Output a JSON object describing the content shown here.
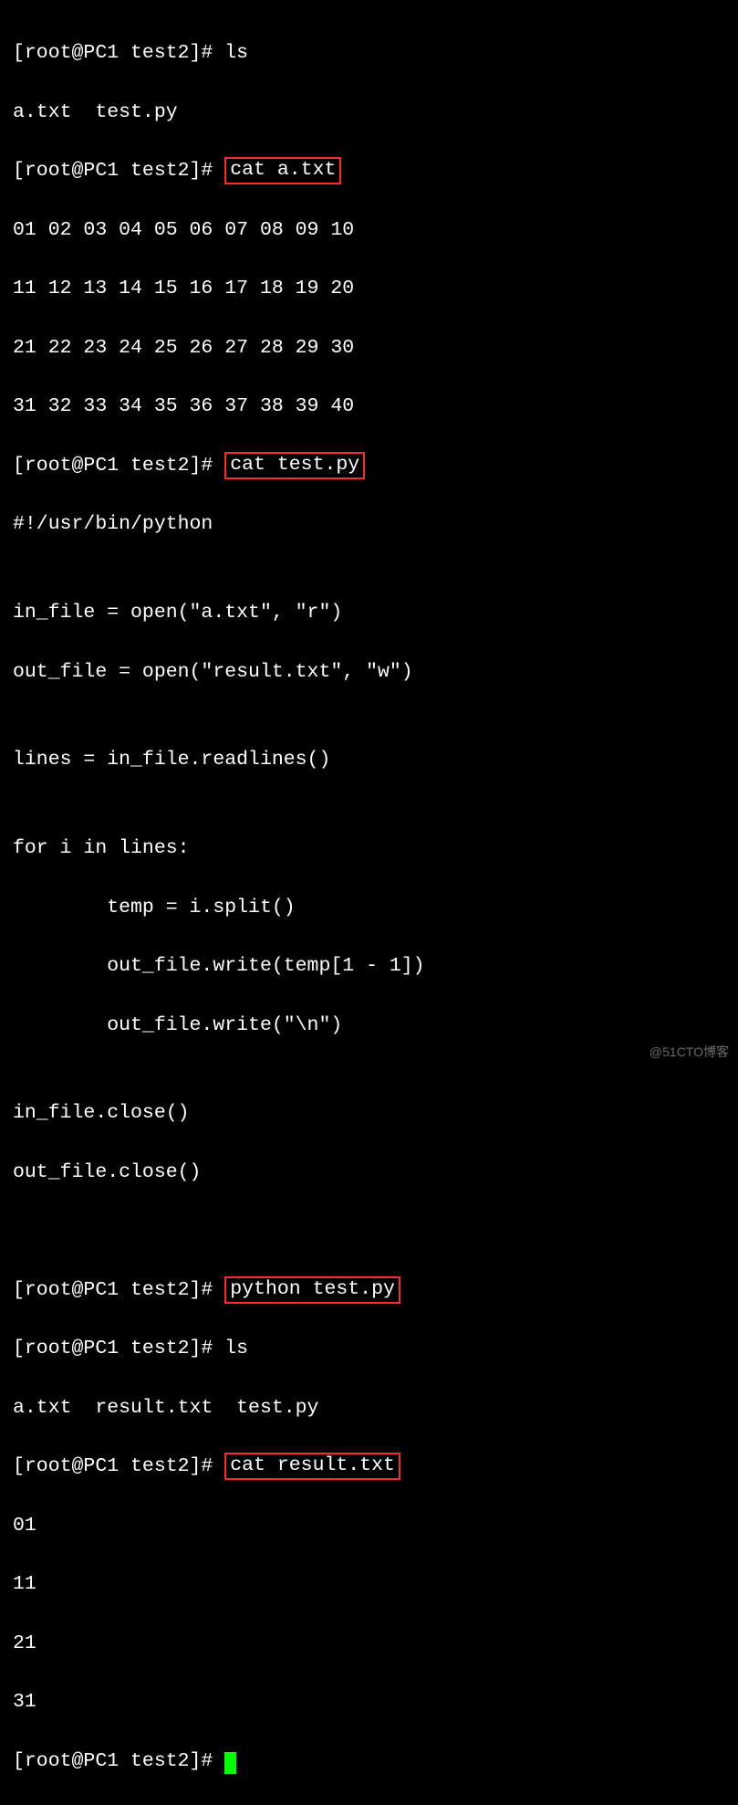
{
  "prompt": "[root@PC1 test2]#",
  "cmds": {
    "ls1": "ls",
    "ls1_out": "a.txt  test.py",
    "cat_a": "cat a.txt",
    "a_rows": [
      "01 02 03 04 05 06 07 08 09 10",
      "11 12 13 14 15 16 17 18 19 20",
      "21 22 23 24 25 26 27 28 29 30",
      "31 32 33 34 35 36 37 38 39 40"
    ],
    "cat_test": "cat test.py",
    "testpy_lines": [
      "#!/usr/bin/python",
      "",
      "in_file = open(\"a.txt\", \"r\")",
      "out_file = open(\"result.txt\", \"w\")",
      "",
      "lines = in_file.readlines()",
      "",
      "for i in lines:",
      "        temp = i.split()",
      "        out_file.write(temp[1 - 1])",
      "        out_file.write(\"\\n\")",
      "",
      "in_file.close()",
      "out_file.close()"
    ],
    "python": "python test.py",
    "ls2": "ls",
    "ls2_out": "a.txt  result.txt  test.py",
    "cat_result": "cat result.txt",
    "result_lines": [
      "01",
      "11",
      "21",
      "31"
    ]
  },
  "watermark": "@51CTO博客"
}
